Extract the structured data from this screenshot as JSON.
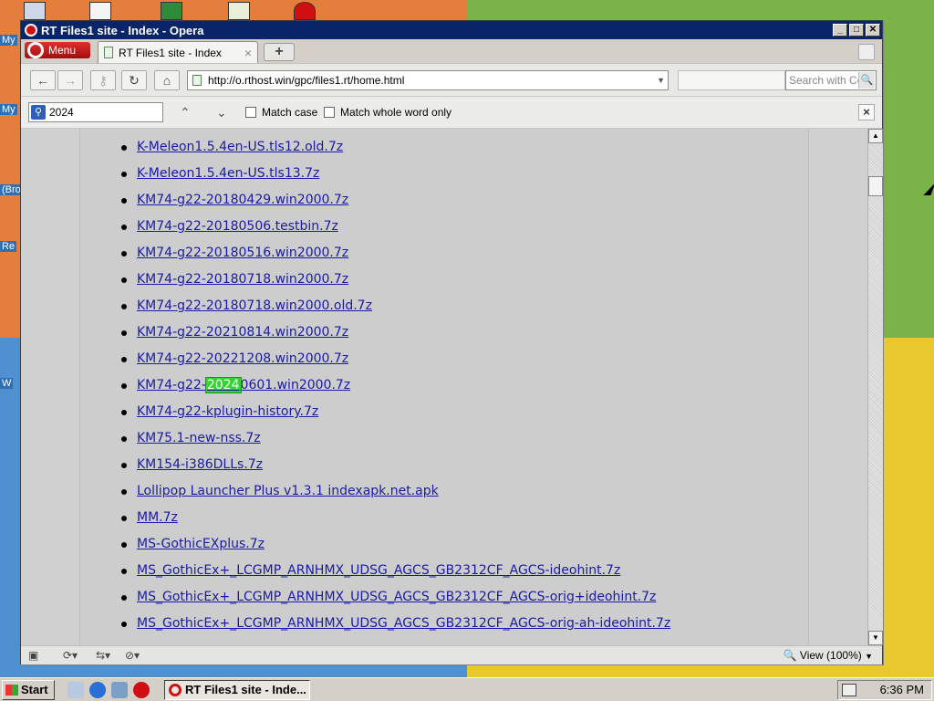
{
  "desktop": {
    "labels": [
      "My",
      "My",
      "(Bro",
      "Re",
      "W"
    ]
  },
  "window": {
    "title": "RT Files1 site - Index - Opera",
    "min": "_",
    "max": "□",
    "close": "✕"
  },
  "tabs": {
    "menu_label": "Menu",
    "active_tab": "RT Files1 site - Index",
    "close_tab": "×",
    "new_tab": "+"
  },
  "nav": {
    "back": "←",
    "forward": "→",
    "key": "⚷",
    "reload": "↻",
    "home": "⌂",
    "url": "http://o.rthost.win/gpc/files1.rt/home.html",
    "dropdown": "▼",
    "search_placeholder": "Search with Co",
    "search_go": "🔍"
  },
  "find": {
    "query": "2024",
    "prev": "⌃",
    "next": "⌄",
    "match_case": "Match case",
    "whole_word": "Match whole word only",
    "close": "×"
  },
  "files": [
    "K-Meleon1.5.4en-US.tls12.old.7z",
    "K-Meleon1.5.4en-US.tls13.7z",
    "KM74-g22-20180429.win2000.7z",
    "KM74-g22-20180506.testbin.7z",
    "KM74-g22-20180516.win2000.7z",
    "KM74-g22-20180718.win2000.7z",
    "KM74-g22-20180718.win2000.old.7z",
    "KM74-g22-20210814.win2000.7z",
    "KM74-g22-20221208.win2000.7z",
    "KM74-g22-20240601.win2000.7z",
    "KM74-g22-kplugin-history.7z",
    "KM75.1-new-nss.7z",
    "KM154-i386DLLs.7z",
    "Lollipop Launcher Plus v1.3.1 indexapk.net.apk",
    "MM.7z",
    "MS-GothicEXplus.7z",
    "MS_GothicEx+_LCGMP_ARNHMX_UDSG_AGCS_GB2312CF_AGCS-ideohint.7z",
    "MS_GothicEx+_LCGMP_ARNHMX_UDSG_AGCS_GB2312CF_AGCS-orig+ideohint.7z",
    "MS_GothicEx+_LCGMP_ARNHMX_UDSG_AGCS_GB2312CF_AGCS-orig-ah-ideohint.7z"
  ],
  "highlight": {
    "row": 9,
    "before": "KM74-g22-",
    "match": "2024",
    "after": "0601.win2000.7z"
  },
  "status": {
    "zoom": "View (100%)",
    "zoom_dd": "▼"
  },
  "taskbar": {
    "start": "Start",
    "task": "RT Files1 site - Inde...",
    "clock": "6:36 PM"
  },
  "colors": {
    "titlebar": "#0a246a",
    "link": "#1a1aa6",
    "highlight": "#32d632",
    "opera_red": "#d01010"
  }
}
